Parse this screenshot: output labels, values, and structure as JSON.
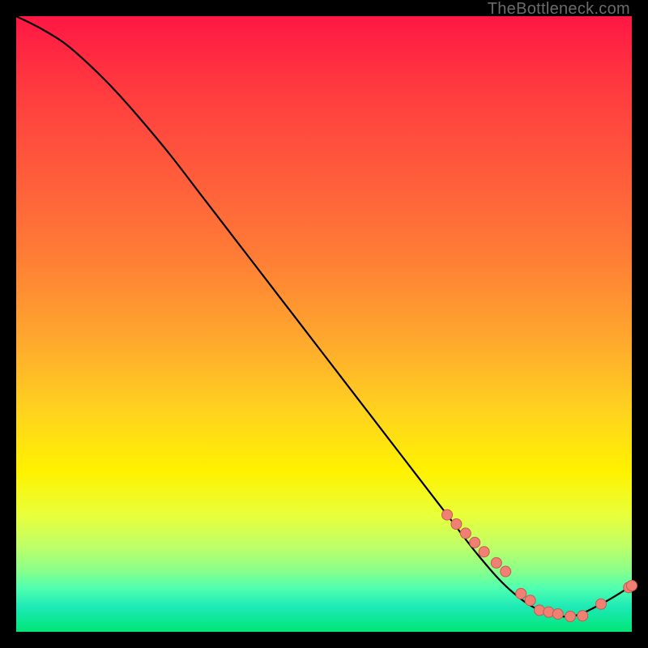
{
  "watermark": "TheBottleneck.com",
  "colors": {
    "curve": "#000000",
    "markers_fill": "#f08074",
    "markers_stroke": "#c9594f",
    "background_black": "#000000"
  },
  "chart_data": {
    "type": "line",
    "title": "",
    "xlabel": "",
    "ylabel": "",
    "xlim": [
      0,
      100
    ],
    "ylim": [
      0,
      100
    ],
    "grid": false,
    "legend": false,
    "series": [
      {
        "name": "bottleneck-curve",
        "x": [
          0,
          4,
          8,
          12,
          16,
          20,
          25,
          30,
          35,
          40,
          45,
          50,
          55,
          60,
          65,
          70,
          75,
          80,
          85,
          90,
          95,
          100
        ],
        "y": [
          100,
          98,
          95.5,
          92,
          88,
          83.5,
          77.5,
          71,
          64.5,
          58,
          51.5,
          45,
          38.5,
          32,
          25.5,
          19,
          12.5,
          7,
          3.5,
          2.5,
          4.5,
          7.5
        ]
      }
    ],
    "markers": {
      "name": "highlight-points",
      "x": [
        70,
        71.5,
        73,
        74.5,
        76,
        78,
        79.5,
        82,
        83.5,
        85,
        86.5,
        88,
        90,
        92,
        95,
        99.5,
        100
      ],
      "y": [
        19,
        17.5,
        16,
        14.5,
        13,
        11.2,
        9.8,
        6.2,
        5.1,
        3.5,
        3.2,
        2.9,
        2.5,
        2.6,
        4.5,
        7.2,
        7.5
      ]
    }
  }
}
